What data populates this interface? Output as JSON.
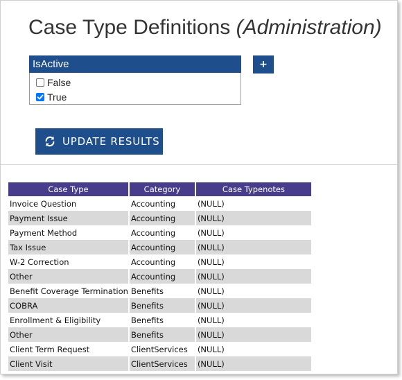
{
  "page": {
    "title_main": "Case Type Definitions ",
    "title_sub": "(Administration)"
  },
  "filter": {
    "header": "IsActive",
    "options": [
      {
        "label": "False",
        "checked": false
      },
      {
        "label": "True",
        "checked": true
      }
    ],
    "add_label": "+"
  },
  "update_button": {
    "label": "UPDATE RESULTS",
    "icon": "refresh-icon"
  },
  "table": {
    "columns": [
      "Case Type",
      "Category",
      "Case Typenotes"
    ],
    "rows": [
      [
        "Invoice Question",
        "Accounting",
        "(NULL)"
      ],
      [
        "Payment Issue",
        "Accounting",
        "(NULL)"
      ],
      [
        "Payment Method",
        "Accounting",
        "(NULL)"
      ],
      [
        "Tax Issue",
        "Accounting",
        "(NULL)"
      ],
      [
        "W-2 Correction",
        "Accounting",
        "(NULL)"
      ],
      [
        "Other",
        "Accounting",
        "(NULL)"
      ],
      [
        "Benefit Coverage Termination",
        "Benefits",
        "(NULL)"
      ],
      [
        "COBRA",
        "Benefits",
        "(NULL)"
      ],
      [
        "Enrollment & Eligibility",
        "Benefits",
        "(NULL)"
      ],
      [
        "Other",
        "Benefits",
        "(NULL)"
      ],
      [
        "Client Term Request",
        "ClientServices",
        "(NULL)"
      ],
      [
        "Client Visit",
        "ClientServices",
        "(NULL)"
      ]
    ]
  },
  "colors": {
    "primary_blue": "#1e4f8c",
    "table_header": "#483d8b",
    "row_alt": "#d9d9d9"
  }
}
